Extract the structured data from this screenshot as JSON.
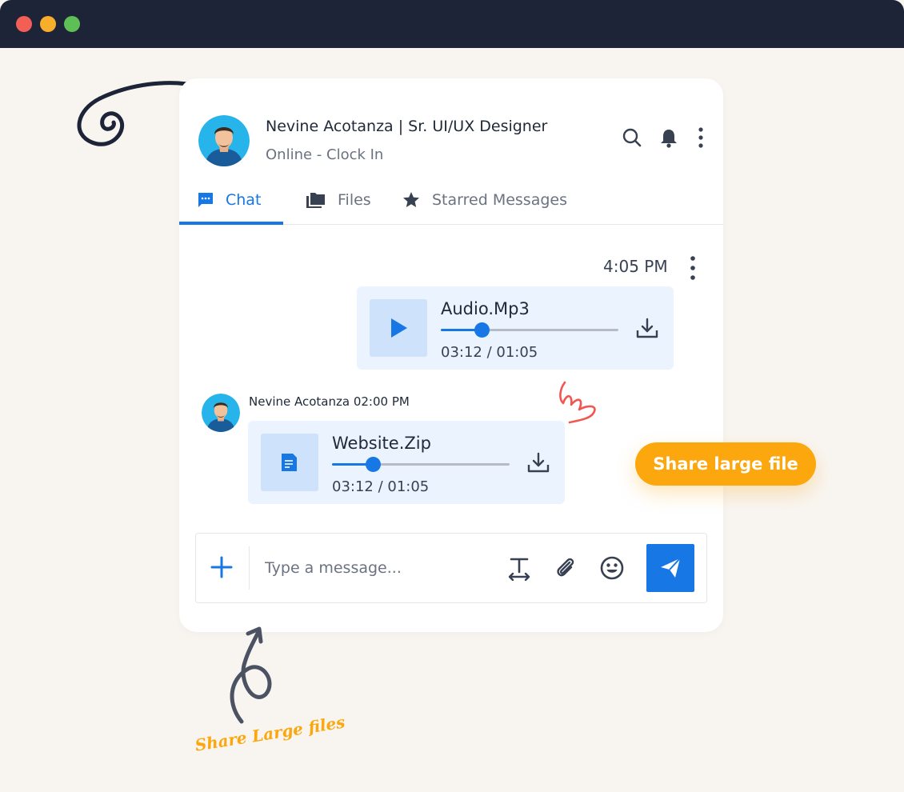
{
  "window": {
    "controls": [
      "close",
      "minimize",
      "maximize"
    ]
  },
  "header": {
    "name": "Nevine Acotanza | Sr. UI/UX Designer",
    "status": "Online -  Clock In",
    "icons": [
      "search-icon",
      "bell-icon",
      "more-vertical-icon"
    ]
  },
  "tabs": [
    {
      "label": "Chat",
      "icon": "chat-icon",
      "active": true
    },
    {
      "label": "Files",
      "icon": "folders-icon",
      "active": false
    },
    {
      "label": "Starred Messages",
      "icon": "star-icon",
      "active": false
    }
  ],
  "messages": [
    {
      "timestamp": "4:05 PM",
      "file_name": "Audio.Mp3",
      "progress": 0.23,
      "time_label": "03:12 / 01:05",
      "thumb_icon": "play-icon"
    },
    {
      "sender": "Nevine Acotanza 02:00 PM",
      "file_name": "Website.Zip",
      "progress": 0.23,
      "time_label": "03:12 / 01:05",
      "thumb_icon": "file-icon"
    }
  ],
  "composer": {
    "placeholder": "Type a message...",
    "tools": [
      "text-format-icon",
      "paperclip-icon",
      "emoji-icon"
    ],
    "send_icon": "send-icon"
  },
  "callouts": {
    "pill": "Share large file",
    "handwritten": "Share Large files"
  },
  "colors": {
    "accent": "#1677e5",
    "highlight": "#fba70d",
    "titlebar": "#1d2437",
    "background": "#f8f5f1",
    "bubble": "#ebf3fe"
  }
}
